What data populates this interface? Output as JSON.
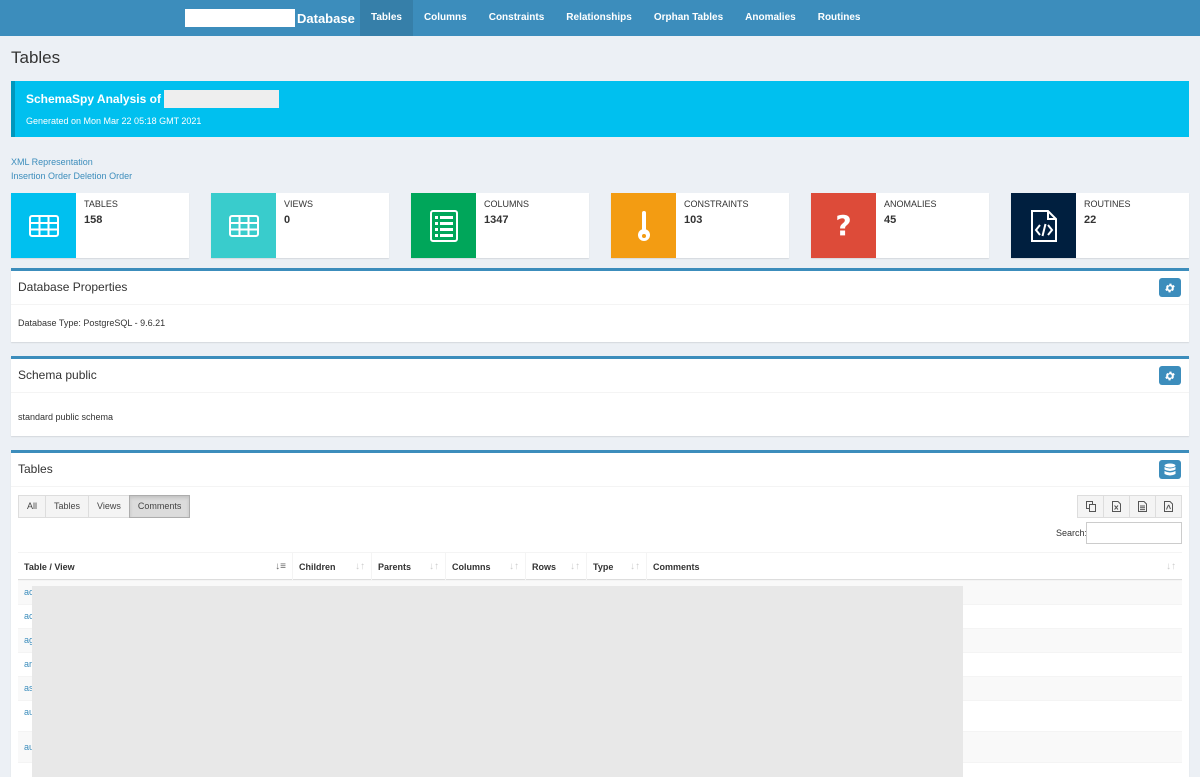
{
  "nav": {
    "brand_suffix": "Database",
    "items": [
      "Tables",
      "Columns",
      "Constraints",
      "Relationships",
      "Orphan Tables",
      "Anomalies",
      "Routines"
    ],
    "active": "Tables"
  },
  "page_title": "Tables",
  "callout": {
    "title": "SchemaSpy Analysis of",
    "generated": "Generated on Mon Mar 22 05:18 GMT 2021"
  },
  "links": {
    "xml": "XML Representation",
    "insertion": "Insertion Order",
    "deletion": "Deletion Order"
  },
  "stats": [
    {
      "label": "TABLES",
      "value": "158",
      "color": "#00c0ef",
      "icon": "table-icon"
    },
    {
      "label": "VIEWS",
      "value": "0",
      "color": "#39cccc",
      "icon": "table-icon"
    },
    {
      "label": "COLUMNS",
      "value": "1347",
      "color": "#00a65a",
      "icon": "list-icon"
    },
    {
      "label": "CONSTRAINTS",
      "value": "103",
      "color": "#f39c12",
      "icon": "key-icon"
    },
    {
      "label": "ANOMALIES",
      "value": "45",
      "color": "#dd4b39",
      "icon": "question-icon"
    },
    {
      "label": "ROUTINES",
      "value": "22",
      "color": "#001f3f",
      "icon": "code-file-icon"
    }
  ],
  "db_props": {
    "title": "Database Properties",
    "body": "Database Type: PostgreSQL - 9.6.21"
  },
  "schema": {
    "title": "Schema public",
    "body": "standard public schema"
  },
  "tables_panel": {
    "title": "Tables",
    "filters": [
      "All",
      "Tables",
      "Views",
      "Comments"
    ],
    "active_filter": "Comments",
    "search_label": "Search:",
    "search_value": "",
    "columns": [
      "Table / View",
      "Children",
      "Parents",
      "Columns",
      "Rows",
      "Type",
      "Comments"
    ],
    "rows": [
      "ac",
      "ac",
      "ag",
      "ar",
      "as",
      "au",
      "au",
      "au"
    ]
  },
  "colors": {
    "navbar": "#3c8dbc",
    "callout": "#00c0ef",
    "background": "#ecf0f5"
  }
}
